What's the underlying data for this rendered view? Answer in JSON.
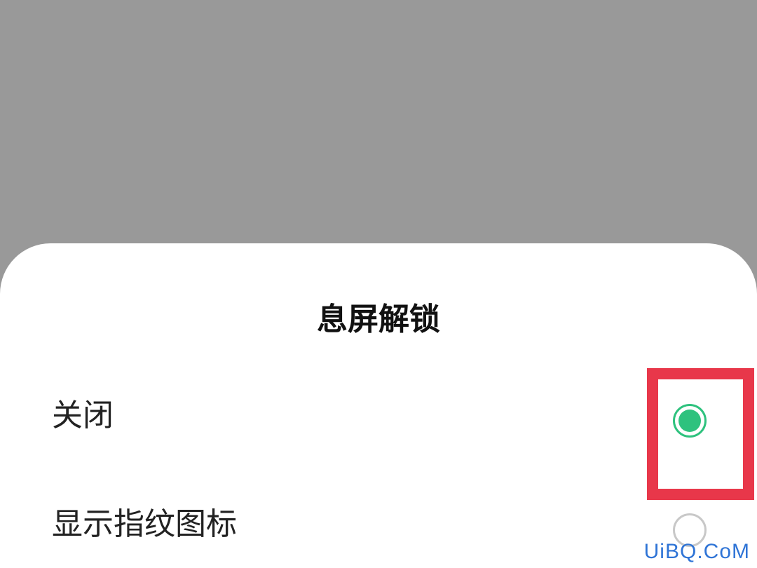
{
  "sheet": {
    "title": "息屏解锁",
    "options": [
      {
        "label": "关闭",
        "selected": true
      },
      {
        "label": "显示指纹图标",
        "selected": false
      }
    ]
  },
  "colors": {
    "backdrop": "#999999",
    "accent": "#2ec27e",
    "highlight": "#e8374a",
    "watermark": "#2f74d6"
  },
  "watermark": "UiBQ.CoM"
}
